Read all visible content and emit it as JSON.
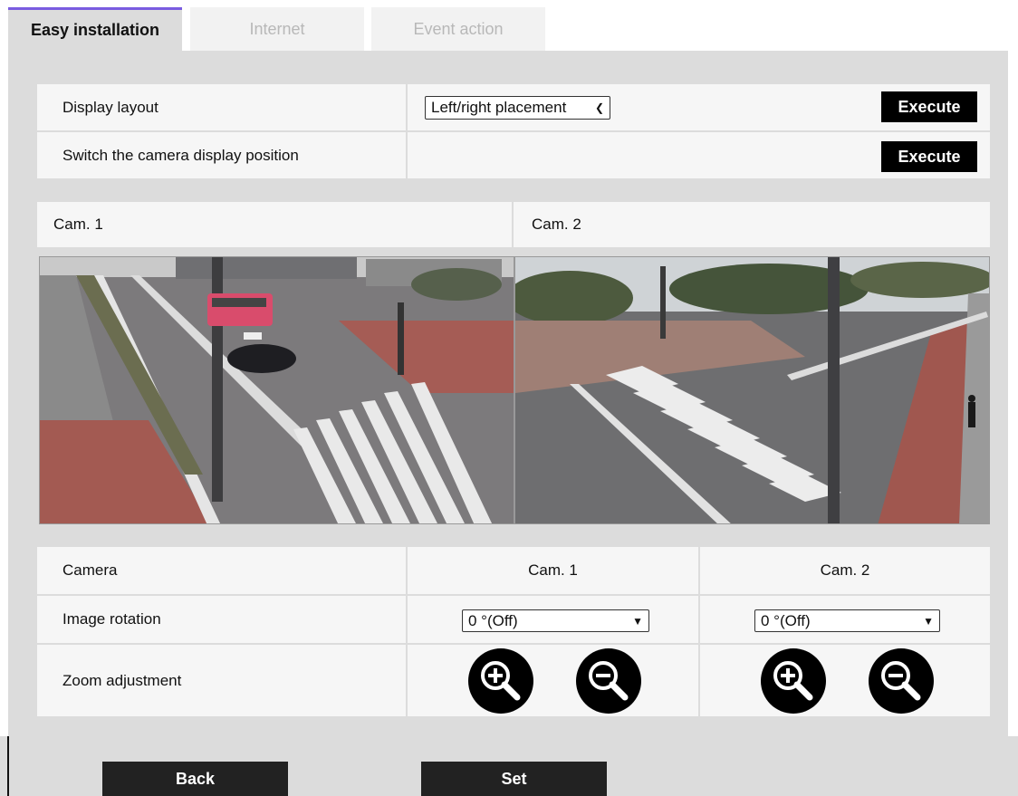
{
  "tabs": [
    {
      "label": "Easy installation",
      "active": true
    },
    {
      "label": "Internet",
      "active": false
    },
    {
      "label": "Event action",
      "active": false
    }
  ],
  "display_layout": {
    "label": "Display layout",
    "select_value": "Left/right placement",
    "execute_label": "Execute"
  },
  "switch_position": {
    "label": "Switch the camera display position",
    "execute_label": "Execute"
  },
  "cameras": {
    "cam1_label": "Cam. 1",
    "cam2_label": "Cam. 2"
  },
  "settings": {
    "camera_label": "Camera",
    "col1": "Cam. 1",
    "col2": "Cam. 2",
    "rotation_label": "Image rotation",
    "rotation_cam1": "0 °(Off)",
    "rotation_cam2": "0 °(Off)",
    "zoom_label": "Zoom adjustment"
  },
  "buttons": {
    "back": "Back",
    "set": "Set"
  },
  "icons": {
    "zoom_in": "zoom-in-icon",
    "zoom_out": "zoom-out-icon",
    "dropdown": "chevron-down-icon"
  },
  "colors": {
    "active_tab_accent": "#7a5ce0",
    "panel_bg": "#dcdcdc",
    "button_bg": "#000000"
  }
}
